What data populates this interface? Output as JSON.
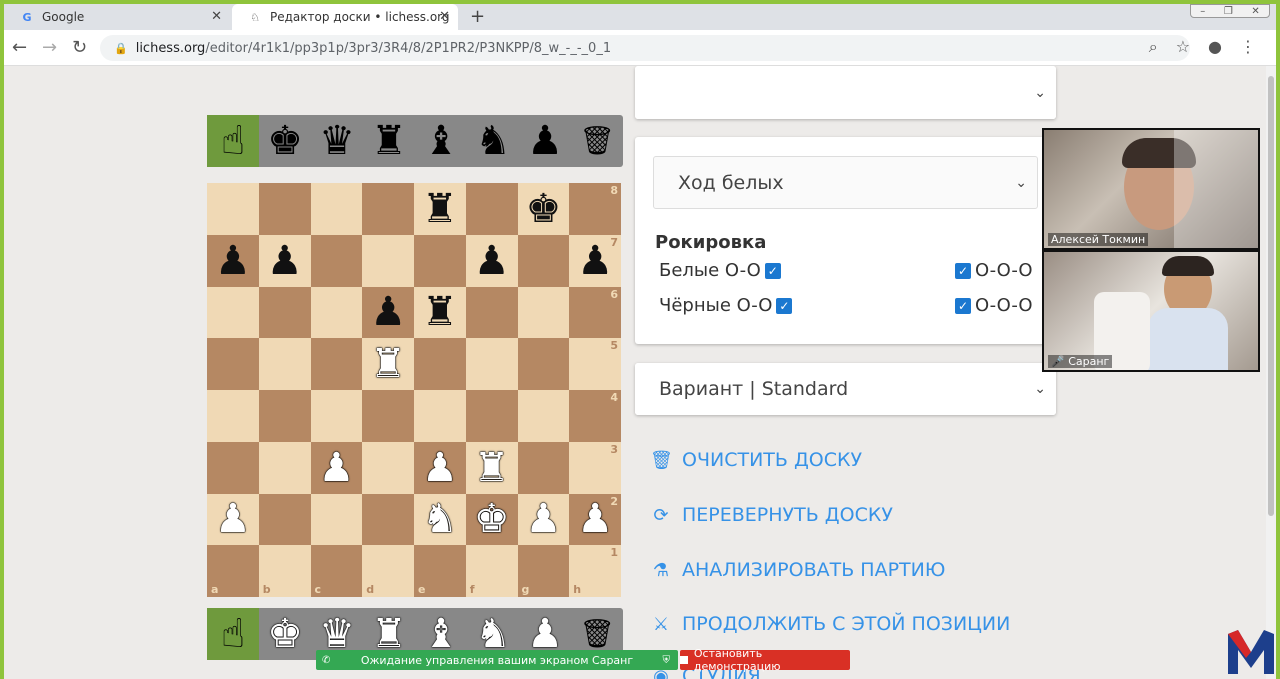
{
  "browser": {
    "tabs": [
      {
        "label": "Google",
        "icon": "G"
      },
      {
        "label": "Редактор доски • lichess.org",
        "icon": "lichess-icon"
      }
    ],
    "url_host": "lichess.org",
    "url_path": "/editor/4r1k1/pp3p1p/3pr3/3R4/8/2P1PR2/P3NKPP/8_w_-_-_0_1"
  },
  "board": {
    "ranks": [
      "8",
      "7",
      "6",
      "5",
      "4",
      "3",
      "2",
      "1"
    ],
    "files": [
      "a",
      "b",
      "c",
      "d",
      "e",
      "f",
      "g",
      "h"
    ],
    "position": [
      [
        "",
        "",
        "",
        "",
        "r",
        "",
        "k",
        ""
      ],
      [
        "p",
        "p",
        "",
        "",
        "",
        "p",
        "",
        "p"
      ],
      [
        "",
        "",
        "",
        "p",
        "r",
        "",
        "",
        ""
      ],
      [
        "",
        "",
        "",
        "R",
        "",
        "",
        "",
        ""
      ],
      [
        "",
        "",
        "",
        "",
        "",
        "",
        "",
        ""
      ],
      [
        "",
        "",
        "P",
        "",
        "P",
        "R",
        "",
        ""
      ],
      [
        "P",
        "",
        "",
        "",
        "N",
        "K",
        "P",
        "P"
      ],
      [
        "",
        "",
        "",
        "",
        "",
        "",
        "",
        ""
      ]
    ]
  },
  "spare_top": [
    "☝",
    "♚",
    "♛",
    "♜",
    "♝",
    "♞",
    "♟",
    "🗑"
  ],
  "spare_bottom": [
    "☝",
    "♚",
    "♛",
    "♜",
    "♝",
    "♞",
    "♟",
    "🗑"
  ],
  "editor": {
    "top_select": "",
    "turn_select": "Ход белых",
    "castling_title": "Рокировка",
    "white_oo": "Белые O-O",
    "white_ooo": "O-O-O",
    "black_oo": "Чёрные O-O",
    "black_ooo": "O-O-O",
    "variant_select": "Вариант | Standard"
  },
  "actions": {
    "clear": "ОЧИСТИТЬ ДОСКУ",
    "flip": "ПЕРЕВЕРНУТЬ ДОСКУ",
    "analyse": "АНАЛИЗИРОВАТЬ ПАРТИЮ",
    "continue": "ПРОДОЛЖИТЬ С ЭТОЙ ПОЗИЦИИ",
    "study": "СТУДИЯ"
  },
  "video": {
    "person1": "Алексей Токмин",
    "person2": "Саранг"
  },
  "screenshare": {
    "waiting": "Ожидание управления вашим экраном Саранг",
    "stop": "Остановить демонстрацию"
  },
  "colors": {
    "accent": "#3692e7",
    "board_light": "#f0d9b5",
    "board_dark": "#b58863",
    "frame": "#8fc43c"
  }
}
